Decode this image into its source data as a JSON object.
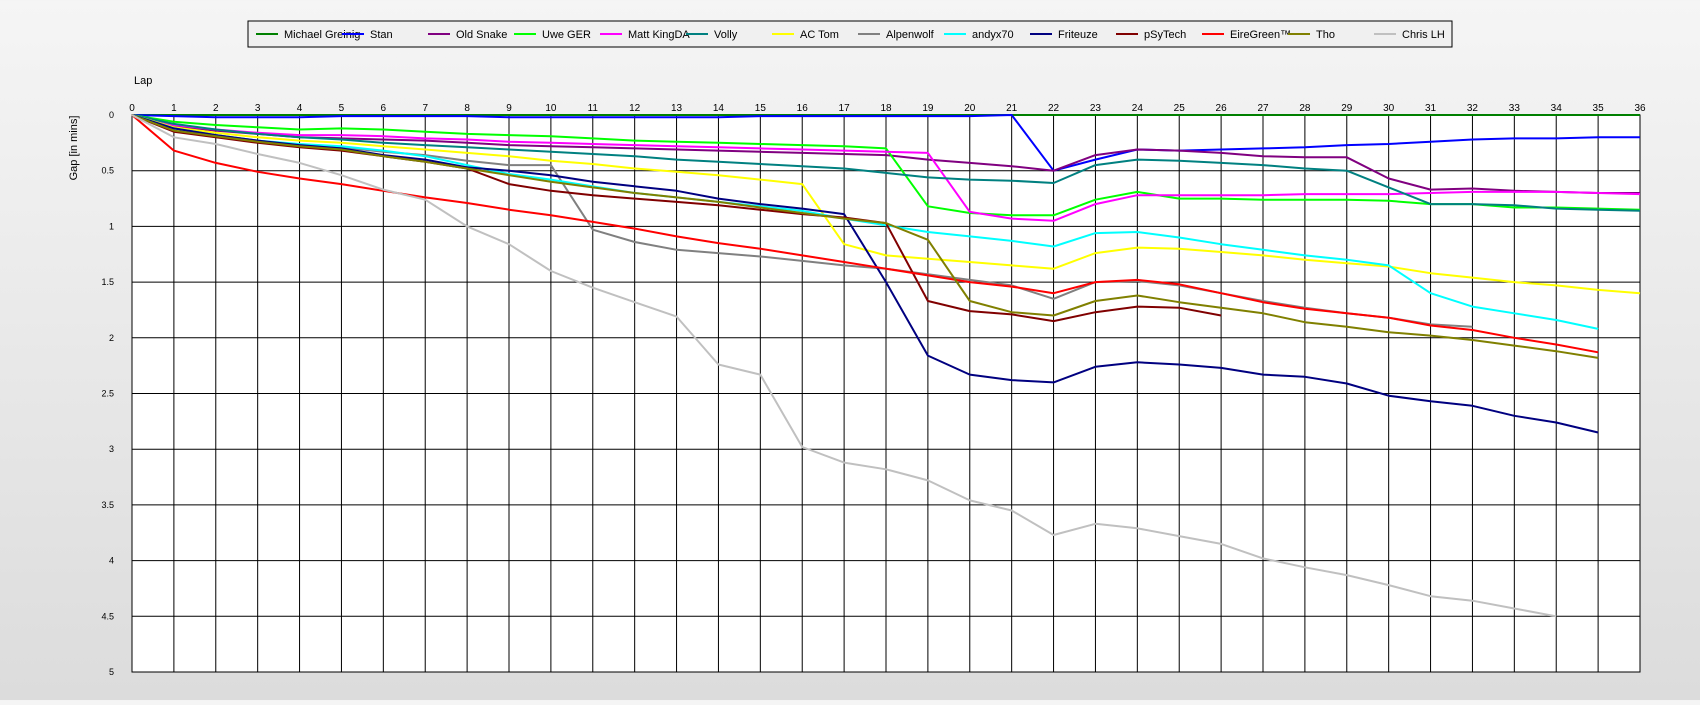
{
  "chart_data": {
    "type": "line",
    "xlabel": "Lap",
    "ylabel": "Gap [in mins]",
    "xlim": [
      0,
      36
    ],
    "ylim": [
      0,
      5
    ],
    "y_inverted": true,
    "grid": true,
    "legend_position": "top",
    "x": [
      0,
      1,
      2,
      3,
      4,
      5,
      6,
      7,
      8,
      9,
      10,
      11,
      12,
      13,
      14,
      15,
      16,
      17,
      18,
      19,
      20,
      21,
      22,
      23,
      24,
      25,
      26,
      27,
      28,
      29,
      30,
      31,
      32,
      33,
      34,
      35,
      36
    ],
    "x_ticks": [
      "0",
      "1",
      "2",
      "3",
      "4",
      "5",
      "6",
      "7",
      "8",
      "9",
      "10",
      "11",
      "12",
      "13",
      "14",
      "15",
      "16",
      "17",
      "18",
      "19",
      "20",
      "21",
      "22",
      "23",
      "24",
      "25",
      "26",
      "27",
      "28",
      "29",
      "30",
      "31",
      "32",
      "33",
      "34",
      "35",
      "36"
    ],
    "y_ticks": [
      "0",
      "0.5",
      "1",
      "1.5",
      "2",
      "2.5",
      "3",
      "3.5",
      "4",
      "4.5",
      "5"
    ],
    "series": [
      {
        "name": "Michael Greinig",
        "color": "#008000",
        "values": [
          0,
          0,
          0,
          0,
          0,
          0,
          0,
          0,
          0,
          0,
          0,
          0,
          0,
          0,
          0,
          0,
          0,
          0,
          0,
          0,
          0,
          0,
          0,
          0,
          0,
          0,
          0,
          0,
          0,
          0,
          0,
          0,
          0,
          0,
          0,
          0,
          0
        ]
      },
      {
        "name": "Stan",
        "color": "#0000ff",
        "values": [
          0,
          0.01,
          0.02,
          0.02,
          0.02,
          0.01,
          0.01,
          0.01,
          0.01,
          0.02,
          0.02,
          0.02,
          0.02,
          0.02,
          0.02,
          0.01,
          0.01,
          0.01,
          0.01,
          0.01,
          0.01,
          0,
          0.5,
          0.4,
          0.31,
          0.32,
          0.31,
          0.3,
          0.29,
          0.27,
          0.26,
          0.24,
          0.22,
          0.21,
          0.21,
          0.2,
          0.2
        ]
      },
      {
        "name": "Old Snake",
        "color": "#800080",
        "values": [
          0,
          0.1,
          0.14,
          0.17,
          0.2,
          0.21,
          0.22,
          0.23,
          0.25,
          0.27,
          0.28,
          0.29,
          0.3,
          0.31,
          0.32,
          0.33,
          0.34,
          0.35,
          0.36,
          0.4,
          0.43,
          0.46,
          0.5,
          0.36,
          0.31,
          0.32,
          0.34,
          0.37,
          0.38,
          0.38,
          0.57,
          0.67,
          0.66,
          0.68,
          0.69,
          0.7,
          0.7
        ]
      },
      {
        "name": "Uwe GER",
        "color": "#00ff00",
        "values": [
          0,
          0.06,
          0.09,
          0.11,
          0.13,
          0.12,
          0.13,
          0.15,
          0.17,
          0.18,
          0.19,
          0.21,
          0.23,
          0.24,
          0.25,
          0.26,
          0.27,
          0.28,
          0.3,
          0.82,
          0.88,
          0.9,
          0.9,
          0.76,
          0.69,
          0.75,
          0.75,
          0.76,
          0.76,
          0.76,
          0.77,
          0.8,
          0.8,
          0.83,
          0.83,
          0.84,
          0.85
        ]
      },
      {
        "name": "Matt KingDA",
        "color": "#ff00ff",
        "values": [
          0,
          0.09,
          0.13,
          0.16,
          0.18,
          0.18,
          0.19,
          0.21,
          0.22,
          0.24,
          0.25,
          0.26,
          0.27,
          0.28,
          0.29,
          0.3,
          0.31,
          0.32,
          0.33,
          0.34,
          0.87,
          0.93,
          0.95,
          0.8,
          0.72,
          0.72,
          0.72,
          0.72,
          0.71,
          0.71,
          0.71,
          0.7,
          0.69,
          0.69,
          0.69,
          0.7,
          0.71
        ]
      },
      {
        "name": "Volly",
        "color": "#008080",
        "values": [
          0,
          0.08,
          0.13,
          0.17,
          0.2,
          0.22,
          0.25,
          0.27,
          0.29,
          0.31,
          0.33,
          0.35,
          0.37,
          0.4,
          0.42,
          0.44,
          0.46,
          0.48,
          0.52,
          0.56,
          0.58,
          0.59,
          0.61,
          0.45,
          0.4,
          0.41,
          0.43,
          0.45,
          0.48,
          0.5,
          0.65,
          0.8,
          0.8,
          0.81,
          0.84,
          0.85,
          0.86
        ]
      },
      {
        "name": "AC Tom",
        "color": "#ffff00",
        "values": [
          0,
          0.11,
          0.16,
          0.2,
          0.23,
          0.25,
          0.28,
          0.31,
          0.34,
          0.37,
          0.41,
          0.44,
          0.48,
          0.51,
          0.54,
          0.58,
          0.62,
          1.16,
          1.26,
          1.29,
          1.32,
          1.35,
          1.38,
          1.24,
          1.19,
          1.2,
          1.23,
          1.26,
          1.3,
          1.33,
          1.36,
          1.42,
          1.46,
          1.5,
          1.53,
          1.57,
          1.6
        ]
      },
      {
        "name": "Alpenwolf",
        "color": "#808080",
        "values": [
          0,
          0.12,
          0.18,
          0.23,
          0.27,
          0.29,
          0.33,
          0.36,
          0.41,
          0.45,
          0.45,
          1.03,
          1.14,
          1.21,
          1.24,
          1.27,
          1.31,
          1.35,
          1.38,
          1.43,
          1.48,
          1.53,
          1.65,
          1.5,
          1.49,
          1.53,
          1.6,
          1.67,
          1.73,
          1.78,
          1.82,
          1.88,
          1.9
        ]
      },
      {
        "name": "andyx70",
        "color": "#00ffff",
        "values": [
          0,
          0.12,
          0.18,
          0.23,
          0.26,
          0.28,
          0.32,
          0.37,
          0.45,
          0.53,
          0.58,
          0.64,
          0.7,
          0.74,
          0.78,
          0.82,
          0.86,
          0.93,
          0.99,
          1.05,
          1.09,
          1.13,
          1.18,
          1.06,
          1.05,
          1.1,
          1.16,
          1.21,
          1.26,
          1.3,
          1.35,
          1.6,
          1.72,
          1.78,
          1.84,
          1.92
        ]
      },
      {
        "name": "Friteuze",
        "color": "#000080",
        "values": [
          0,
          0.12,
          0.18,
          0.23,
          0.27,
          0.3,
          0.36,
          0.4,
          0.47,
          0.5,
          0.54,
          0.6,
          0.64,
          0.68,
          0.75,
          0.8,
          0.84,
          0.89,
          1.5,
          2.16,
          2.33,
          2.38,
          2.4,
          2.26,
          2.22,
          2.24,
          2.27,
          2.33,
          2.35,
          2.41,
          2.52,
          2.57,
          2.61,
          2.7,
          2.76,
          2.85
        ]
      },
      {
        "name": "pSyTech",
        "color": "#800000",
        "values": [
          0,
          0.15,
          0.2,
          0.25,
          0.29,
          0.32,
          0.37,
          0.42,
          0.48,
          0.62,
          0.68,
          0.72,
          0.75,
          0.78,
          0.81,
          0.85,
          0.89,
          0.92,
          0.97,
          1.67,
          1.76,
          1.79,
          1.85,
          1.77,
          1.72,
          1.73,
          1.8
        ]
      },
      {
        "name": "EireGreen™",
        "color": "#ff0000",
        "values": [
          0,
          0.32,
          0.43,
          0.51,
          0.57,
          0.62,
          0.68,
          0.74,
          0.79,
          0.85,
          0.9,
          0.96,
          1.02,
          1.09,
          1.15,
          1.2,
          1.26,
          1.32,
          1.38,
          1.44,
          1.5,
          1.54,
          1.6,
          1.5,
          1.48,
          1.52,
          1.6,
          1.68,
          1.74,
          1.78,
          1.82,
          1.89,
          1.93,
          2,
          2.06,
          2.13
        ]
      },
      {
        "name": "Tho",
        "color": "#808000",
        "values": [
          0,
          0.14,
          0.19,
          0.24,
          0.28,
          0.31,
          0.37,
          0.42,
          0.48,
          0.54,
          0.6,
          0.65,
          0.7,
          0.74,
          0.78,
          0.83,
          0.88,
          0.93,
          0.97,
          1.12,
          1.67,
          1.77,
          1.8,
          1.67,
          1.62,
          1.68,
          1.73,
          1.78,
          1.86,
          1.9,
          1.95,
          1.98,
          2.02,
          2.07,
          2.12,
          2.18
        ]
      },
      {
        "name": "Chris LH",
        "color": "#c0c0c0",
        "values": [
          0,
          0.2,
          0.26,
          0.35,
          0.43,
          0.54,
          0.67,
          0.76,
          1,
          1.16,
          1.4,
          1.55,
          1.68,
          1.81,
          2.24,
          2.33,
          2.98,
          3.12,
          3.18,
          3.28,
          3.46,
          3.55,
          3.77,
          3.67,
          3.71,
          3.78,
          3.85,
          3.98,
          4.06,
          4.13,
          4.22,
          4.32,
          4.36,
          4.43,
          4.5
        ]
      }
    ]
  }
}
